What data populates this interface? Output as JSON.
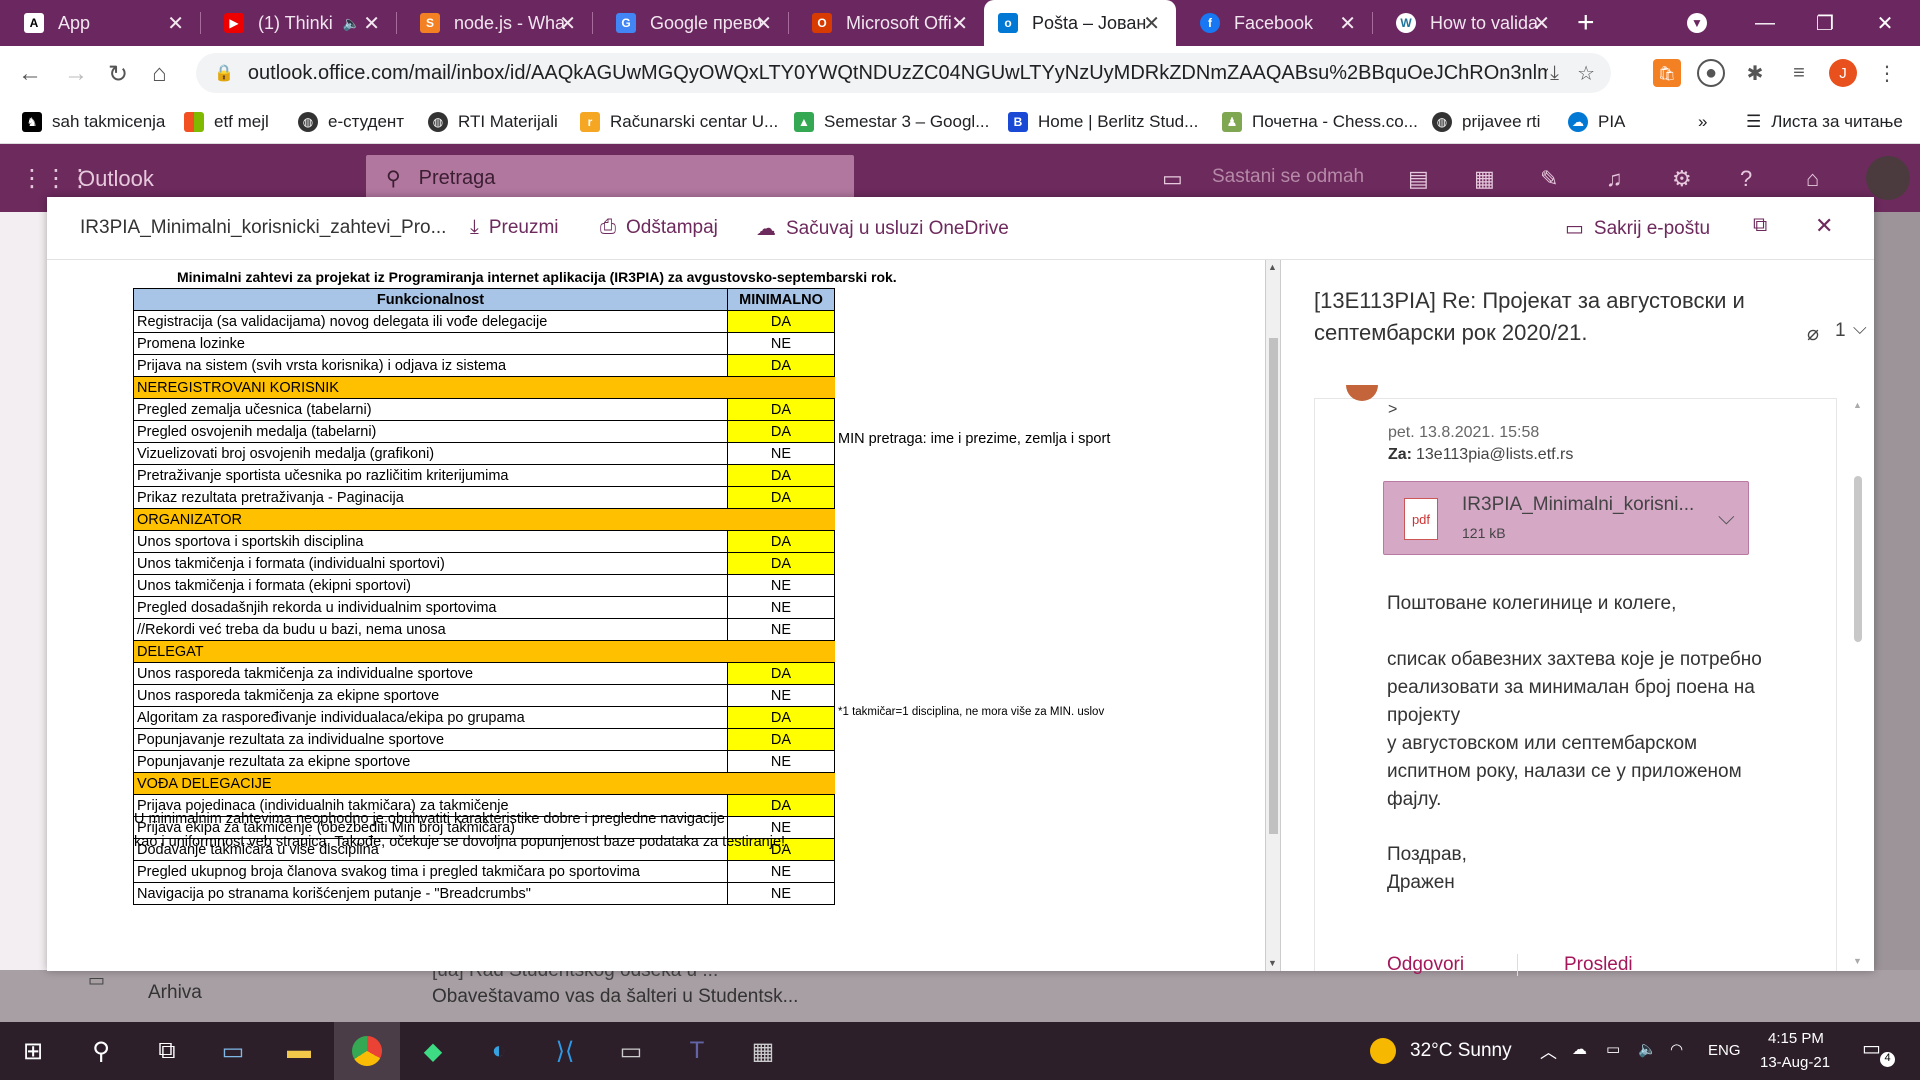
{
  "browser": {
    "tabs": [
      {
        "title": "App",
        "icon": "A"
      },
      {
        "title": "(1) Thinki",
        "icon": "▶"
      },
      {
        "title": "node.js - Wha",
        "icon": "S"
      },
      {
        "title": "Google прево",
        "icon": "G"
      },
      {
        "title": "Microsoft Offi",
        "icon": "O"
      },
      {
        "title": "Pošta – Јован",
        "icon": "o"
      },
      {
        "title": "Facebook",
        "icon": "f"
      },
      {
        "title": "How to valida",
        "icon": "W"
      }
    ],
    "url": "outlook.office.com/mail/inbox/id/AAQkAGUwMGQyOWQxLTY0YWQtNDUzZC04NGUwLTYyNzUyMDRkZDNmZAAQABsu%2BBquOeJChROn3nlmr4o...",
    "profile_initial": "J",
    "bookmarks": [
      {
        "label": "sah takmicenja"
      },
      {
        "label": "etf mejl"
      },
      {
        "label": "e-студент"
      },
      {
        "label": "RTI Materijali"
      },
      {
        "label": "Računarski centar U..."
      },
      {
        "label": "Semestar 3 – Googl..."
      },
      {
        "label": "Home | Berlitz Stud..."
      },
      {
        "label": "Почетна - Chess.co..."
      },
      {
        "label": "prijavee rti"
      },
      {
        "label": "PIA"
      }
    ],
    "reading_list": "Листа за читање",
    "more": "»"
  },
  "outlook": {
    "app_name": "Outlook",
    "search_placeholder": "Pretraga",
    "meet_now": "Sastani se odmah",
    "folder_archive": "Arhiva",
    "bg_preview": "Obaveštavamo vas da šalteri u Studentsk...",
    "bg_preview_top": "[ua] Rad Studentskog odseka u ..."
  },
  "viewer": {
    "file_name": "IR3PIA_Minimalni_korisnicki_zahtevi_Pro...",
    "download": "Preuzmi",
    "print": "Odštampaj",
    "save_onedrive": "Sačuvaj u usluzi OneDrive",
    "hide_email": "Sakrij e-poštu"
  },
  "document": {
    "title": "Minimalni zahtevi za projekat iz Programiranja internet aplikacija (IR3PIA) za avgustovsko-septembarski rok.",
    "header": {
      "feature": "Funkcionalnost",
      "min": "MINIMALNO"
    },
    "rows": [
      {
        "type": "row",
        "label": "Registracija (sa validacijama) novog delegata ili vođe delegacije",
        "value": "DA"
      },
      {
        "type": "row",
        "label": "Promena lozinke",
        "value": "NE"
      },
      {
        "type": "row",
        "label": "Prijava na sistem (svih vrsta korisnika) i odjava iz sistema",
        "value": "DA"
      },
      {
        "type": "section",
        "label": "NEREGISTROVANI KORISNIK"
      },
      {
        "type": "row",
        "label": "Pregled zemalja učesnica (tabelarni)",
        "value": "DA"
      },
      {
        "type": "row",
        "label": "Pregled osvojenih medalja (tabelarni)",
        "value": "DA"
      },
      {
        "type": "row",
        "label": "Vizuelizovati broj osvojenih medalja (grafikoni)",
        "value": "NE"
      },
      {
        "type": "row",
        "label": "Pretraživanje sportista učesnika po različitim kriterijumima",
        "value": "DA"
      },
      {
        "type": "row",
        "label": "Prikaz rezultata pretraživanja - Paginacija",
        "value": "DA"
      },
      {
        "type": "section",
        "label": "ORGANIZATOR"
      },
      {
        "type": "row",
        "label": "Unos sportova i sportskih disciplina",
        "value": "DA"
      },
      {
        "type": "row",
        "label": "Unos takmičenja i formata (individualni sportovi)",
        "value": "DA"
      },
      {
        "type": "row",
        "label": "Unos takmičenja i formata (ekipni sportovi)",
        "value": "NE"
      },
      {
        "type": "row",
        "label": "Pregled dosadašnjih rekorda u individualnim sportovima",
        "value": "NE"
      },
      {
        "type": "row",
        "label": "//Rekordi već treba da budu u bazi, nema unosa",
        "value": "NE"
      },
      {
        "type": "section",
        "label": "DELEGAT"
      },
      {
        "type": "row",
        "label": "Unos rasporeda takmičenja za individualne sportove",
        "value": "DA"
      },
      {
        "type": "row",
        "label": "Unos rasporeda takmičenja za ekipne sportove",
        "value": "NE"
      },
      {
        "type": "row",
        "label": "Algoritam za raspoređivanje individualaca/ekipa po grupama",
        "value": "DA"
      },
      {
        "type": "row",
        "label": "Popunjavanje rezultata za individualne sportove",
        "value": "DA"
      },
      {
        "type": "row",
        "label": "Popunjavanje rezultata za ekipne sportove",
        "value": "NE"
      },
      {
        "type": "section",
        "label": "VOĐA DELEGACIJE"
      },
      {
        "type": "row",
        "label": "Prijava pojedinaca (individualnih takmičara) za takmičenje",
        "value": "DA"
      },
      {
        "type": "row",
        "label": "Prijava ekipa za takmičenje (obezbediti Min broj takmičara)",
        "value": "NE"
      },
      {
        "type": "row",
        "label": "Dodavanje takmičara u više disciplina",
        "value": "DA"
      },
      {
        "type": "row",
        "label": "Pregled ukupnog broja članova svakog tima i pregled takmičara po sportovima",
        "value": "NE"
      },
      {
        "type": "row",
        "label": "Navigacija po stranama korišćenjem putanje - \"Breadcrumbs\"",
        "value": "NE"
      }
    ],
    "note_search": "MIN pretraga: ime i prezime, zemlja i sport",
    "note_competitor": "*1 takmičar=1 disciplina, ne mora više za MIN. uslov",
    "para1": "U minimalnim zahtevima neophodno je obuhvatiti karakteristike dobre i pregledne navigacije",
    "para2": "kao i uniformnost veb stranica. Takođe, očekuje se dovoljna popunjenost baze podataka za testiranje!"
  },
  "email": {
    "subject": "[13E113PIA] Re: Пројекат за августовски и септембарски рок 2020/21.",
    "attachment_count": "1",
    "quote_marker": ">",
    "date": "pet. 13.8.2021. 15:58",
    "to_label": "Za:",
    "to": "13e113pia@lists.etf.rs",
    "attachment_name": "IR3PIA_Minimalni_korisni...",
    "attachment_size": "121 kB",
    "attachment_type": "pdf",
    "greeting": "Поштоване колегинице и колеге,",
    "body_lines": [
      "списак обавезних захтева које је потребно",
      "реализовати за минималан број поена на",
      "пројекту",
      "у августовском или септембарском",
      "испитном року, налази се у приложеном",
      "фајлу."
    ],
    "regards": "Поздрав,",
    "signature": "Дражен",
    "reply": "Odgovori",
    "forward": "Prosledi"
  },
  "taskbar": {
    "weather": "32°C  Sunny",
    "lang": "ENG",
    "time": "4:15 PM",
    "date": "13-Aug-21",
    "notif_count": "4"
  }
}
